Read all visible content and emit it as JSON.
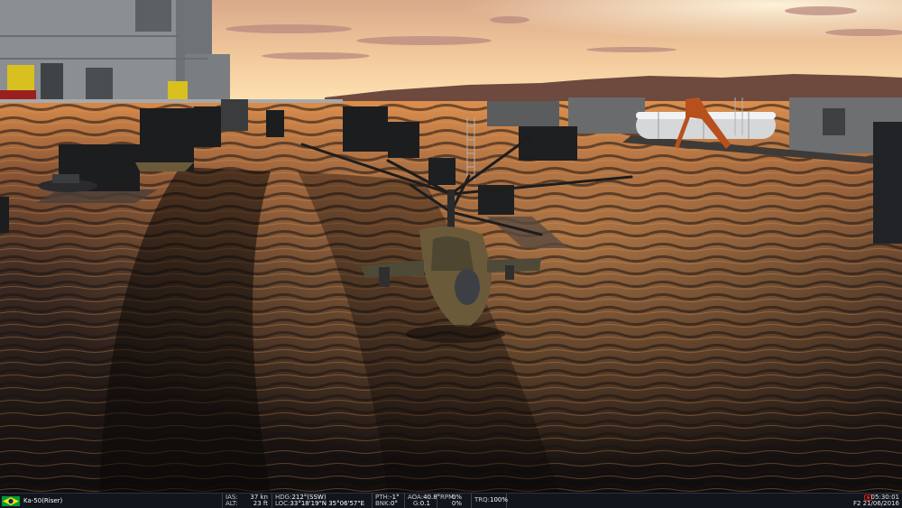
{
  "status_bar": {
    "aircraft": "Ka-50(Riser)",
    "flag_icon": "brazil-flag-icon",
    "ias": {
      "label": "IAS:",
      "value": "37 kn"
    },
    "alt": {
      "label": "ALT:",
      "value": "23 ft"
    },
    "hdg": {
      "label": "HDG:",
      "value": "212°(SSW)"
    },
    "loc": {
      "label": "LOC:",
      "value": "33°18'19\"N 35°06'57\"E"
    },
    "pth": {
      "label": "PTH:",
      "value": "-1°"
    },
    "bnk": {
      "label": "BNK:",
      "value": "0°"
    },
    "aoa": {
      "label": "AOA:",
      "value": "40.8°"
    },
    "g": {
      "label": "G:",
      "value": "0.1"
    },
    "rpm": {
      "label": "RPM:",
      "value1": "0%",
      "value2": "0%"
    },
    "trq": {
      "label": "TRQ:",
      "value": "100%"
    },
    "time": "05:30:01",
    "date": "F2 21/06/2016",
    "record_icon": "record-icon"
  },
  "colors": {
    "sky_top": "#e7b98f",
    "horizon_glow": "#ffe6b0",
    "water_highlight": "#c67a3a",
    "status_bg": "#12161c",
    "brazil_green": "#009b3a",
    "brazil_yellow": "#fedf00",
    "brazil_blue": "#002776"
  }
}
